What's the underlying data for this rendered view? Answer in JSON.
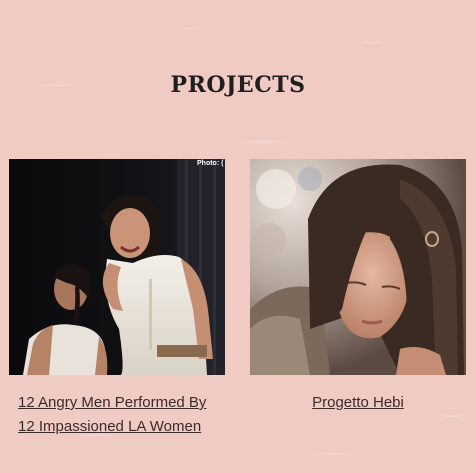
{
  "section": {
    "title": "PROJECTS"
  },
  "projects": [
    {
      "title_line1": "12 Angry Men Performed By ",
      "title_line2": "12 Impassioned LA Women",
      "photo_credit": "Photo: ("
    },
    {
      "title_line1": "Progetto Hebi"
    }
  ],
  "colors": {
    "background": "#f0cbc4",
    "text": "#1f1f1f"
  }
}
